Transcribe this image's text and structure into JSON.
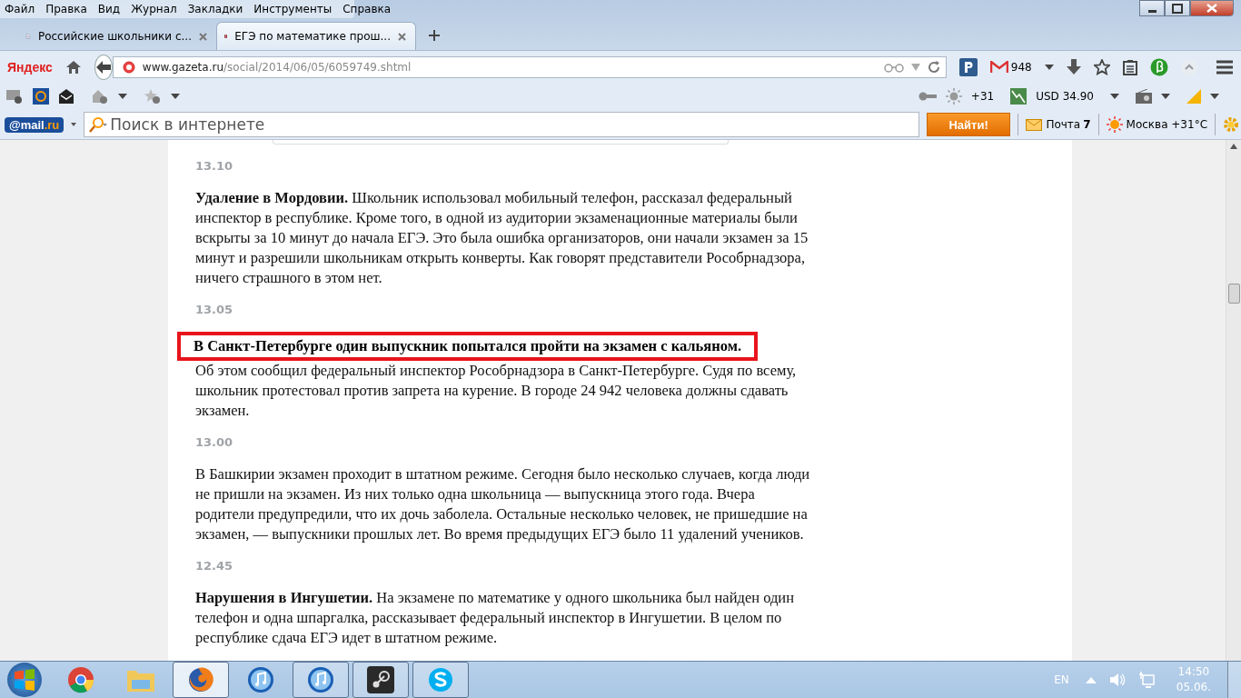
{
  "menu": [
    "Файл",
    "Правка",
    "Вид",
    "Журнал",
    "Закладки",
    "Инструменты",
    "Справка"
  ],
  "tabs": [
    {
      "title": "Российские школьники с...",
      "kind": "page",
      "selected": false
    },
    {
      "title": "ЕГЭ по математике прош...",
      "kind": "gazeta",
      "selected": true
    }
  ],
  "navbar": {
    "logo": "Яндекс",
    "url_host": "www.gazeta.ru",
    "url_path": "/social/2014/06/05/6059749.shtml",
    "mail_count": "948"
  },
  "toolbar": {
    "weather": "+31",
    "currency": "USD 34.90"
  },
  "mailru": {
    "logo_a": "@mail",
    "logo_b": ".ru",
    "search_placeholder": "Поиск в интернете",
    "search_button": "Найти!",
    "mail_label": "Почта",
    "mail_count": "7",
    "city_weather": "Москва +31°C"
  },
  "entries": [
    {
      "time": "13.10",
      "text": "**Удаление в Мордовии.** Школьник использовал мобильный телефон, рассказал федеральный инспектор в республике. Кроме того, в одной из аудитории экзаменационные материалы были вскрыты за 10 минут до начала ЕГЭ. Это была ошибка организаторов, они начали экзамен за 15 минут и разрешили школьникам открыть конверты. Как говорят представители Рособрнадзора, ничего страшного в этом нет.",
      "highlighted": false
    },
    {
      "time": "13.05",
      "lead": "В Санкт-Петербурге один выпускник попытался пройти на экзамен с кальяном.",
      "text": "Об этом сообщил федеральный инспектор Рособрнадзора в Санкт-Петербурге. Судя по всему, школьник протестовал против запрета на курение. В городе 24 942 человека должны сдавать экзамен.",
      "highlighted": true
    },
    {
      "time": "13.00",
      "text": "В Башкирии экзамен проходит в штатном режиме. Сегодня было несколько случаев, когда люди не пришли на экзамен. Из них только одна школьница — выпускница этого года. Вчера родители предупредили, что их дочь заболела. Остальные несколько человек, не пришедшие на экзамен, — выпускники прошлых лет. Во время предыдущих ЕГЭ было 11 удалений учеников.",
      "highlighted": false
    },
    {
      "time": "12.45",
      "text": "**Нарушения в Ингушетии.** На экзамене по математике у одного школьника был найден один телефон и одна шпаргалка, рассказывает федеральный инспектор в Ингушетии. В целом по республике сдача ЕГЭ идет в штатном режиме.",
      "highlighted": false
    }
  ],
  "taskbar": {
    "apps": [
      {
        "kind": "chrome",
        "open": false,
        "selected": false
      },
      {
        "kind": "folder",
        "open": false,
        "selected": false
      },
      {
        "kind": "firefox",
        "open": true,
        "selected": true
      },
      {
        "kind": "itunes",
        "open": false,
        "selected": false
      },
      {
        "kind": "itunes",
        "open": true,
        "selected": false
      },
      {
        "kind": "steam",
        "open": true,
        "selected": false
      },
      {
        "kind": "skype",
        "open": true,
        "selected": false
      }
    ],
    "lang": "EN",
    "time": "14:50",
    "date": "05.06."
  }
}
